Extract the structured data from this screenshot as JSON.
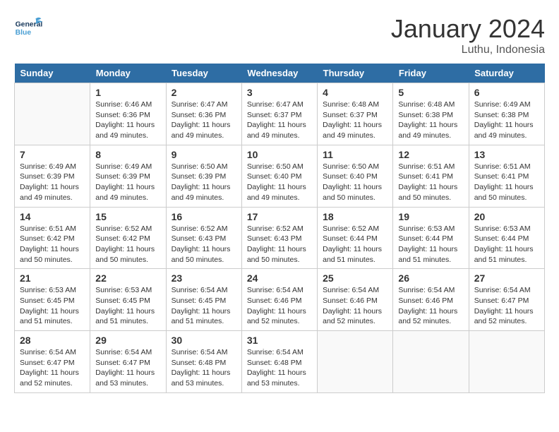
{
  "header": {
    "logo_general": "General",
    "logo_blue": "Blue",
    "month_year": "January 2024",
    "location": "Luthu, Indonesia"
  },
  "days_of_week": [
    "Sunday",
    "Monday",
    "Tuesday",
    "Wednesday",
    "Thursday",
    "Friday",
    "Saturday"
  ],
  "weeks": [
    [
      {
        "num": "",
        "sunrise": "",
        "sunset": "",
        "daylight": ""
      },
      {
        "num": "1",
        "sunrise": "Sunrise: 6:46 AM",
        "sunset": "Sunset: 6:36 PM",
        "daylight": "Daylight: 11 hours and 49 minutes."
      },
      {
        "num": "2",
        "sunrise": "Sunrise: 6:47 AM",
        "sunset": "Sunset: 6:36 PM",
        "daylight": "Daylight: 11 hours and 49 minutes."
      },
      {
        "num": "3",
        "sunrise": "Sunrise: 6:47 AM",
        "sunset": "Sunset: 6:37 PM",
        "daylight": "Daylight: 11 hours and 49 minutes."
      },
      {
        "num": "4",
        "sunrise": "Sunrise: 6:48 AM",
        "sunset": "Sunset: 6:37 PM",
        "daylight": "Daylight: 11 hours and 49 minutes."
      },
      {
        "num": "5",
        "sunrise": "Sunrise: 6:48 AM",
        "sunset": "Sunset: 6:38 PM",
        "daylight": "Daylight: 11 hours and 49 minutes."
      },
      {
        "num": "6",
        "sunrise": "Sunrise: 6:49 AM",
        "sunset": "Sunset: 6:38 PM",
        "daylight": "Daylight: 11 hours and 49 minutes."
      }
    ],
    [
      {
        "num": "7",
        "sunrise": "Sunrise: 6:49 AM",
        "sunset": "Sunset: 6:39 PM",
        "daylight": "Daylight: 11 hours and 49 minutes."
      },
      {
        "num": "8",
        "sunrise": "Sunrise: 6:49 AM",
        "sunset": "Sunset: 6:39 PM",
        "daylight": "Daylight: 11 hours and 49 minutes."
      },
      {
        "num": "9",
        "sunrise": "Sunrise: 6:50 AM",
        "sunset": "Sunset: 6:39 PM",
        "daylight": "Daylight: 11 hours and 49 minutes."
      },
      {
        "num": "10",
        "sunrise": "Sunrise: 6:50 AM",
        "sunset": "Sunset: 6:40 PM",
        "daylight": "Daylight: 11 hours and 49 minutes."
      },
      {
        "num": "11",
        "sunrise": "Sunrise: 6:50 AM",
        "sunset": "Sunset: 6:40 PM",
        "daylight": "Daylight: 11 hours and 50 minutes."
      },
      {
        "num": "12",
        "sunrise": "Sunrise: 6:51 AM",
        "sunset": "Sunset: 6:41 PM",
        "daylight": "Daylight: 11 hours and 50 minutes."
      },
      {
        "num": "13",
        "sunrise": "Sunrise: 6:51 AM",
        "sunset": "Sunset: 6:41 PM",
        "daylight": "Daylight: 11 hours and 50 minutes."
      }
    ],
    [
      {
        "num": "14",
        "sunrise": "Sunrise: 6:51 AM",
        "sunset": "Sunset: 6:42 PM",
        "daylight": "Daylight: 11 hours and 50 minutes."
      },
      {
        "num": "15",
        "sunrise": "Sunrise: 6:52 AM",
        "sunset": "Sunset: 6:42 PM",
        "daylight": "Daylight: 11 hours and 50 minutes."
      },
      {
        "num": "16",
        "sunrise": "Sunrise: 6:52 AM",
        "sunset": "Sunset: 6:43 PM",
        "daylight": "Daylight: 11 hours and 50 minutes."
      },
      {
        "num": "17",
        "sunrise": "Sunrise: 6:52 AM",
        "sunset": "Sunset: 6:43 PM",
        "daylight": "Daylight: 11 hours and 50 minutes."
      },
      {
        "num": "18",
        "sunrise": "Sunrise: 6:52 AM",
        "sunset": "Sunset: 6:44 PM",
        "daylight": "Daylight: 11 hours and 51 minutes."
      },
      {
        "num": "19",
        "sunrise": "Sunrise: 6:53 AM",
        "sunset": "Sunset: 6:44 PM",
        "daylight": "Daylight: 11 hours and 51 minutes."
      },
      {
        "num": "20",
        "sunrise": "Sunrise: 6:53 AM",
        "sunset": "Sunset: 6:44 PM",
        "daylight": "Daylight: 11 hours and 51 minutes."
      }
    ],
    [
      {
        "num": "21",
        "sunrise": "Sunrise: 6:53 AM",
        "sunset": "Sunset: 6:45 PM",
        "daylight": "Daylight: 11 hours and 51 minutes."
      },
      {
        "num": "22",
        "sunrise": "Sunrise: 6:53 AM",
        "sunset": "Sunset: 6:45 PM",
        "daylight": "Daylight: 11 hours and 51 minutes."
      },
      {
        "num": "23",
        "sunrise": "Sunrise: 6:54 AM",
        "sunset": "Sunset: 6:45 PM",
        "daylight": "Daylight: 11 hours and 51 minutes."
      },
      {
        "num": "24",
        "sunrise": "Sunrise: 6:54 AM",
        "sunset": "Sunset: 6:46 PM",
        "daylight": "Daylight: 11 hours and 52 minutes."
      },
      {
        "num": "25",
        "sunrise": "Sunrise: 6:54 AM",
        "sunset": "Sunset: 6:46 PM",
        "daylight": "Daylight: 11 hours and 52 minutes."
      },
      {
        "num": "26",
        "sunrise": "Sunrise: 6:54 AM",
        "sunset": "Sunset: 6:46 PM",
        "daylight": "Daylight: 11 hours and 52 minutes."
      },
      {
        "num": "27",
        "sunrise": "Sunrise: 6:54 AM",
        "sunset": "Sunset: 6:47 PM",
        "daylight": "Daylight: 11 hours and 52 minutes."
      }
    ],
    [
      {
        "num": "28",
        "sunrise": "Sunrise: 6:54 AM",
        "sunset": "Sunset: 6:47 PM",
        "daylight": "Daylight: 11 hours and 52 minutes."
      },
      {
        "num": "29",
        "sunrise": "Sunrise: 6:54 AM",
        "sunset": "Sunset: 6:47 PM",
        "daylight": "Daylight: 11 hours and 53 minutes."
      },
      {
        "num": "30",
        "sunrise": "Sunrise: 6:54 AM",
        "sunset": "Sunset: 6:48 PM",
        "daylight": "Daylight: 11 hours and 53 minutes."
      },
      {
        "num": "31",
        "sunrise": "Sunrise: 6:54 AM",
        "sunset": "Sunset: 6:48 PM",
        "daylight": "Daylight: 11 hours and 53 minutes."
      },
      {
        "num": "",
        "sunrise": "",
        "sunset": "",
        "daylight": ""
      },
      {
        "num": "",
        "sunrise": "",
        "sunset": "",
        "daylight": ""
      },
      {
        "num": "",
        "sunrise": "",
        "sunset": "",
        "daylight": ""
      }
    ]
  ]
}
